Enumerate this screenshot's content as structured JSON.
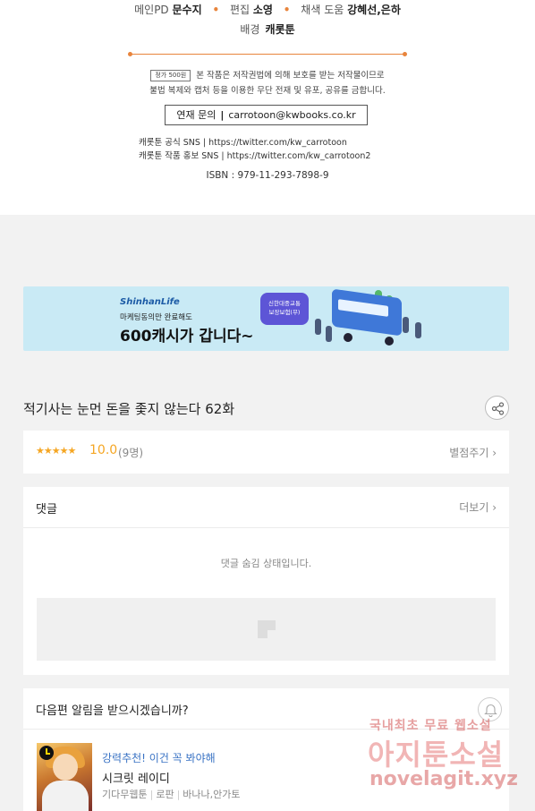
{
  "credits": {
    "main_pd_label": "메인PD",
    "main_pd_name": "문수지",
    "editor_label": "편집",
    "editor_name": "소영",
    "coloring_label": "채색 도움",
    "coloring_names": "강혜선,은하",
    "background_label": "배경",
    "background_name": "캐롯툰",
    "price_label": "정가 500원",
    "copyright_line1": "본 작품은 저작권법에 의해 보호를 받는 저작물이므로",
    "copyright_line2": "불법 복제와 캡처 등을 이용한 무단 전재 및 유포, 공유를 금합니다.",
    "contact_label": "연재 문의",
    "contact_email": "carrotoon@kwbooks.co.kr",
    "sns_official": "캐롯툰 공식 SNS | https://twitter.com/kw_carrotoon",
    "sns_promo": "캐롯툰 작품 홍보 SNS | https://twitter.com/kw_carrotoon2",
    "isbn": "ISBN : 979-11-293-7898-9"
  },
  "banner": {
    "brand": "ShinhanLife",
    "subtitle": "마케팅동의만 완료해도",
    "headline": "600캐시가 갑니다~",
    "badge_line1": "신한대중교통",
    "badge_line2": "보장보험(무)"
  },
  "episode": {
    "title": "적기사는 눈먼 돈을 좇지 않는다 62화"
  },
  "rating": {
    "stars": "★★★★★",
    "score": "10.0",
    "count": "(9명)",
    "rate_link": "별점주기 ›"
  },
  "comments": {
    "header": "댓글",
    "more_link": "더보기 ›",
    "hidden_text": "댓글 숨김 상태입니다."
  },
  "next_episode": {
    "question": "다음편 알림을 받으시겠습니까?",
    "promo": "강력추천! 이건 꼭 봐야해",
    "title": "시크릿 레이디",
    "publisher": "기다무웹툰",
    "genre": "로판",
    "authors": "바나나,안가토"
  },
  "watermark": {
    "line1": "국내최초 무료 웹소설",
    "line2": "아지툰소설",
    "line3": "novelagit.xyz"
  },
  "colors": {
    "accent_orange": "#e8843c",
    "star": "#f5a623",
    "promo_blue": "#3a73c4",
    "banner_bg": "#c9eaf5"
  }
}
